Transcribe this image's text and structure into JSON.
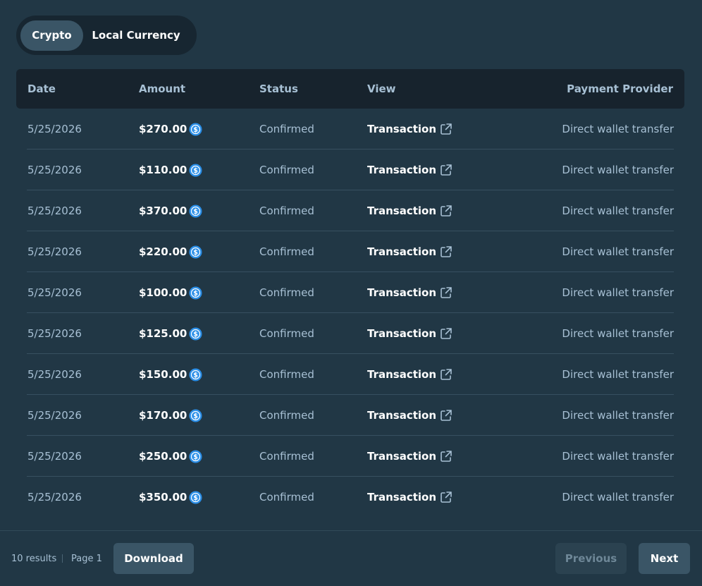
{
  "toggle": {
    "crypto_label": "Crypto",
    "local_label": "Local Currency",
    "active": "crypto"
  },
  "columns": {
    "date": "Date",
    "amount": "Amount",
    "status": "Status",
    "view": "View",
    "provider": "Payment Provider"
  },
  "rows": [
    {
      "date": "5/25/2026",
      "amount": "$270.00",
      "status": "Confirmed",
      "view": "Transaction",
      "provider": "Direct wallet transfer"
    },
    {
      "date": "5/25/2026",
      "amount": "$110.00",
      "status": "Confirmed",
      "view": "Transaction",
      "provider": "Direct wallet transfer"
    },
    {
      "date": "5/25/2026",
      "amount": "$370.00",
      "status": "Confirmed",
      "view": "Transaction",
      "provider": "Direct wallet transfer"
    },
    {
      "date": "5/25/2026",
      "amount": "$220.00",
      "status": "Confirmed",
      "view": "Transaction",
      "provider": "Direct wallet transfer"
    },
    {
      "date": "5/25/2026",
      "amount": "$100.00",
      "status": "Confirmed",
      "view": "Transaction",
      "provider": "Direct wallet transfer"
    },
    {
      "date": "5/25/2026",
      "amount": "$125.00",
      "status": "Confirmed",
      "view": "Transaction",
      "provider": "Direct wallet transfer"
    },
    {
      "date": "5/25/2026",
      "amount": "$150.00",
      "status": "Confirmed",
      "view": "Transaction",
      "provider": "Direct wallet transfer"
    },
    {
      "date": "5/25/2026",
      "amount": "$170.00",
      "status": "Confirmed",
      "view": "Transaction",
      "provider": "Direct wallet transfer"
    },
    {
      "date": "5/25/2026",
      "amount": "$250.00",
      "status": "Confirmed",
      "view": "Transaction",
      "provider": "Direct wallet transfer"
    },
    {
      "date": "5/25/2026",
      "amount": "$350.00",
      "status": "Confirmed",
      "view": "Transaction",
      "provider": "Direct wallet transfer"
    }
  ],
  "icons": {
    "coin": "usdc-coin-icon",
    "external": "external-link-icon"
  },
  "footer": {
    "results": "10 results",
    "page": "Page 1",
    "download_label": "Download",
    "previous_label": "Previous",
    "next_label": "Next"
  },
  "colors": {
    "background": "#213745",
    "header_bg": "#17232d",
    "accent_button": "#3a5566",
    "muted_text": "#a7c0d4",
    "coin_blue": "#2b8fe8"
  }
}
